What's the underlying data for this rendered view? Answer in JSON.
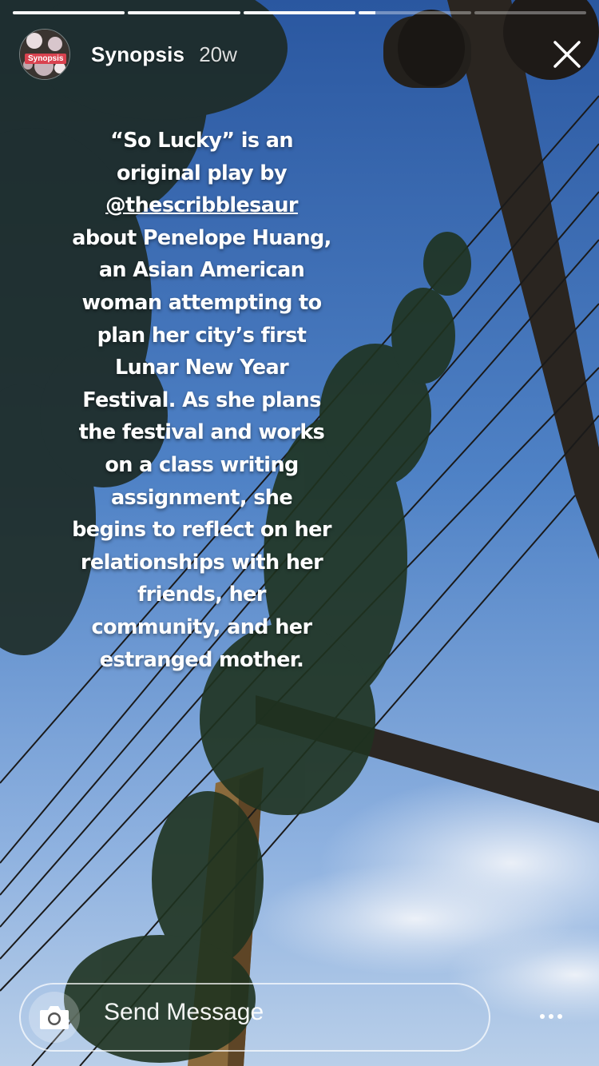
{
  "story": {
    "progress_segments": [
      1,
      1,
      1,
      0.15,
      0
    ],
    "username": "Synopsis",
    "avatar_badge": "Synopsis",
    "age": "20w",
    "text_lines": [
      "“So Lucky” is an",
      "original play by",
      "@thescribblesaur",
      "about Penelope Huang,",
      "an Asian American",
      "woman attempting to",
      "plan her city’s first",
      "Lunar New Year",
      "Festival. As she plans",
      "the festival and works",
      "on a class writing",
      "assignment, she",
      "begins to reflect on her",
      "relationships with her",
      "friends, her",
      "community, and her",
      "estranged mother."
    ]
  },
  "reply": {
    "placeholder": "Send Message"
  },
  "icons": {
    "close": "close-icon",
    "camera": "camera-icon",
    "more": "more-icon"
  },
  "colors": {
    "sky_top": "#2d5ea8",
    "sky_bottom": "#aac6ea",
    "badge": "#d9424f"
  }
}
